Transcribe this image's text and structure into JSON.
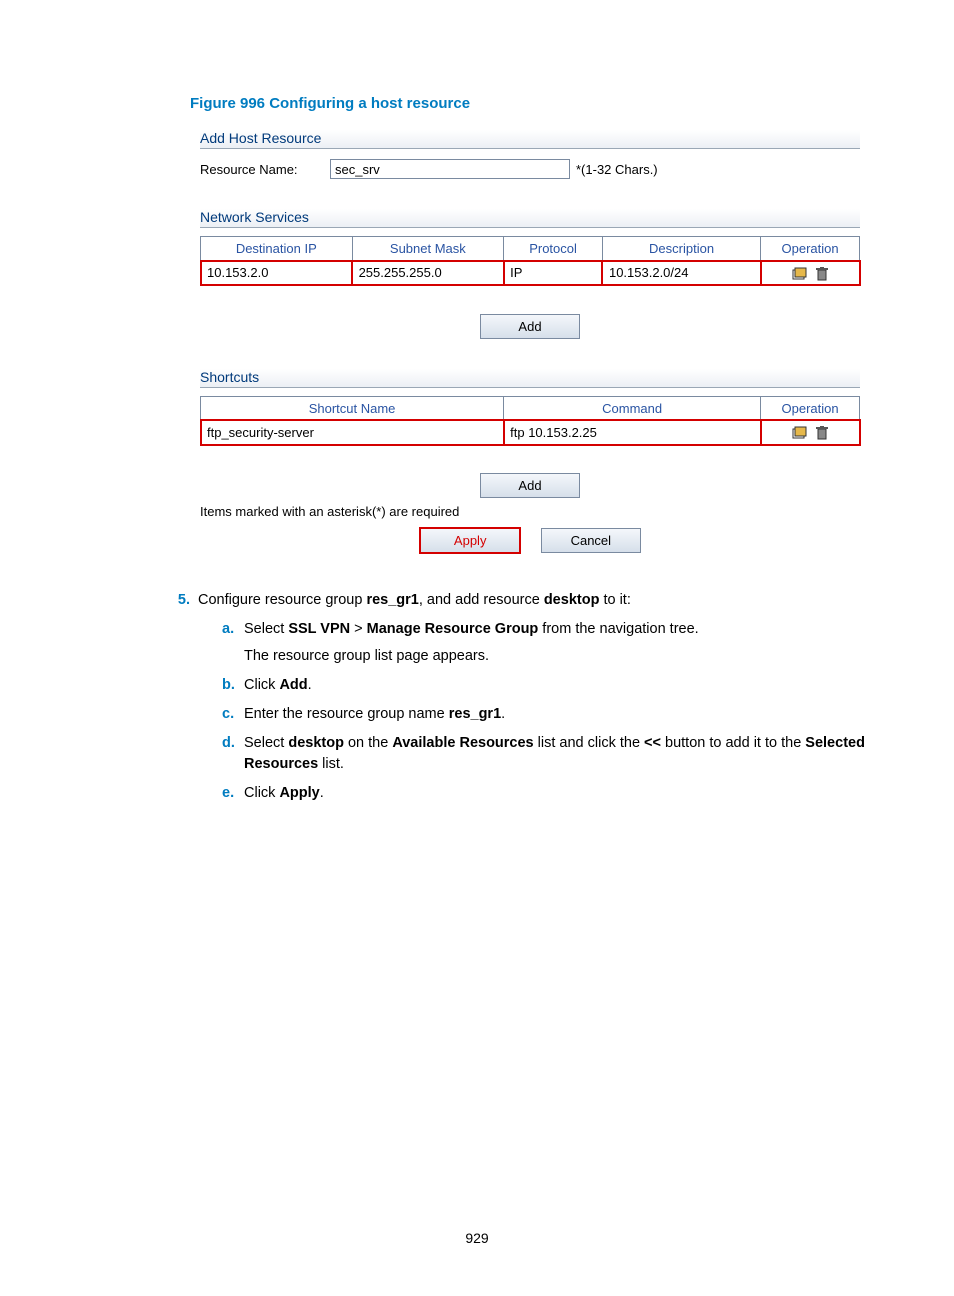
{
  "figure_caption": "Figure 996 Configuring a host resource",
  "sections": {
    "add_host": "Add Host Resource",
    "net_svc": "Network Services",
    "shortcuts": "Shortcuts"
  },
  "resource_name": {
    "label": "Resource Name:",
    "value": "sec_srv",
    "hint": "*(1-32 Chars.)"
  },
  "net_table": {
    "headers": [
      "Destination IP",
      "Subnet Mask",
      "Protocol",
      "Description",
      "Operation"
    ],
    "row": {
      "dest_ip": "10.153.2.0",
      "mask": "255.255.255.0",
      "protocol": "IP",
      "desc": "10.153.2.0/24"
    }
  },
  "shortcut_table": {
    "headers": [
      "Shortcut Name",
      "Command",
      "Operation"
    ],
    "row": {
      "name": "ftp_security-server",
      "cmd": "ftp 10.153.2.25"
    }
  },
  "buttons": {
    "add": "Add",
    "apply": "Apply",
    "cancel": "Cancel"
  },
  "asterisk_note": "Items marked with an asterisk(*) are required",
  "steps": {
    "num5": "5.",
    "text5_pre": "Configure resource group ",
    "text5_b1": "res_gr1",
    "text5_mid": ", and add resource ",
    "text5_b2": "desktop",
    "text5_post": " to it:",
    "a_lbl": "a.",
    "a_pre": "Select ",
    "a_b1": "SSL VPN",
    "a_gt": " > ",
    "a_b2": "Manage Resource Group",
    "a_post": " from the navigation tree.",
    "a_extra": "The resource group list page appears.",
    "b_lbl": "b.",
    "b_pre": "Click ",
    "b_b1": "Add",
    "b_post": ".",
    "c_lbl": "c.",
    "c_pre": "Enter the resource group name ",
    "c_b1": "res_gr1",
    "c_post": ".",
    "d_lbl": "d.",
    "d_pre": "Select ",
    "d_b1": "desktop",
    "d_mid1": " on the ",
    "d_b2": "Available Resources",
    "d_mid2": " list and click the ",
    "d_b3": "<<",
    "d_mid3": " button to add it to the ",
    "d_b4": "Selected Resources",
    "d_post": " list.",
    "e_lbl": "e.",
    "e_pre": "Click ",
    "e_b1": "Apply",
    "e_post": "."
  },
  "page_number": "929"
}
